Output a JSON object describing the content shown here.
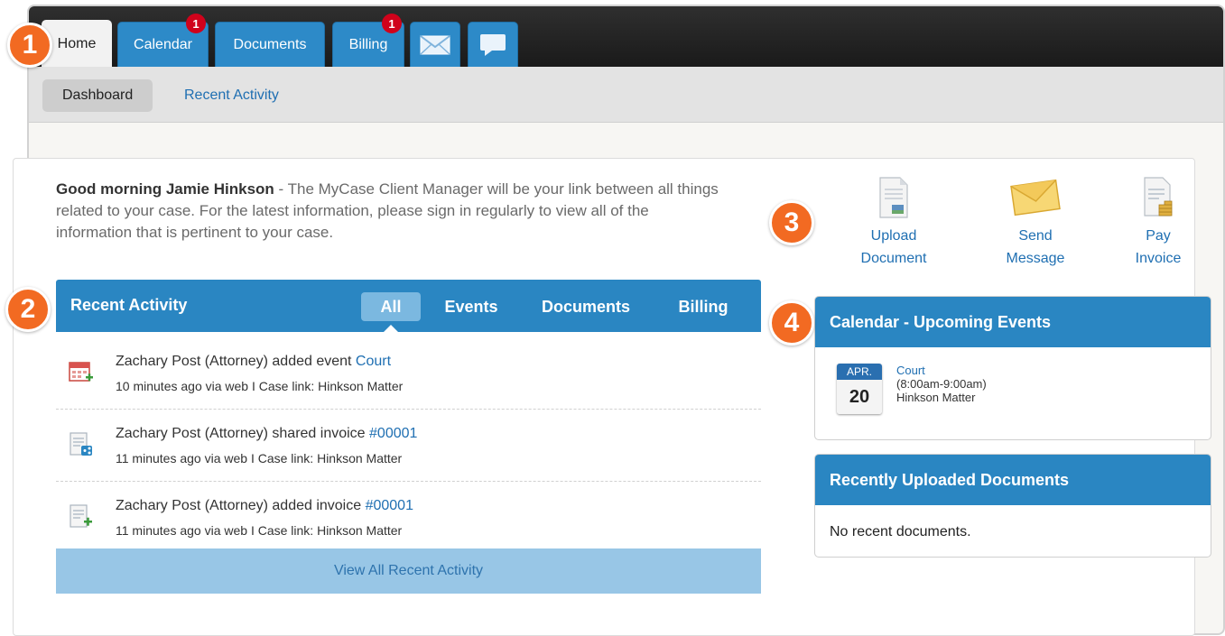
{
  "tabs": [
    {
      "label": "Home"
    },
    {
      "label": "Calendar",
      "badge": "1"
    },
    {
      "label": "Documents"
    },
    {
      "label": "Billing",
      "badge": "1"
    }
  ],
  "icon_tabs": [
    "mail-icon",
    "chat-icon"
  ],
  "subnav": {
    "dashboard": "Dashboard",
    "recent_activity": "Recent Activity"
  },
  "greeting": {
    "name": "Good morning Jamie Hinkson",
    "text": " - The MyCase Client Manager will be your link between all things related to your case. For the latest information, please sign in regularly to view all of the information that is pertinent to your case."
  },
  "recent_activity": {
    "title": "Recent Activity",
    "filters": [
      "All",
      "Events",
      "Documents",
      "Billing"
    ],
    "items": [
      {
        "icon": "calendar-add-icon",
        "text": "Zachary Post (Attorney) added event ",
        "link": "Court",
        "meta_prefix": "10 minutes ago via web I Case link: ",
        "case": "Hinkson Matter"
      },
      {
        "icon": "invoice-share-icon",
        "text": "Zachary Post (Attorney) shared invoice ",
        "link": "#00001",
        "meta_prefix": "11 minutes ago via web I Case link: ",
        "case": "Hinkson Matter"
      },
      {
        "icon": "invoice-add-icon",
        "text": "Zachary Post (Attorney) added invoice ",
        "link": "#00001",
        "meta_prefix": "11 minutes ago via web I Case link: ",
        "case": "Hinkson Matter"
      }
    ],
    "view_all": "View All Recent Activity"
  },
  "quick_actions": [
    {
      "icon": "document-icon",
      "line1": "Upload",
      "line2": "Document"
    },
    {
      "icon": "envelope-icon",
      "line1": "Send",
      "line2": "Message"
    },
    {
      "icon": "invoice-coins-icon",
      "line1": "Pay",
      "line2": "Invoice"
    }
  ],
  "calendar": {
    "title": "Calendar - Upcoming Events",
    "month": "APR.",
    "day": "20",
    "event": "Court",
    "time": "(8:00am-9:00am)",
    "case": "Hinkson Matter"
  },
  "documents": {
    "title": "Recently Uploaded Documents",
    "empty": "No recent documents."
  },
  "markers": [
    "1",
    "2",
    "3",
    "4"
  ],
  "colors": {
    "accent": "#2a86c2",
    "marker": "#f26a22",
    "badge": "#d0021b",
    "link": "#1f6fb2"
  }
}
